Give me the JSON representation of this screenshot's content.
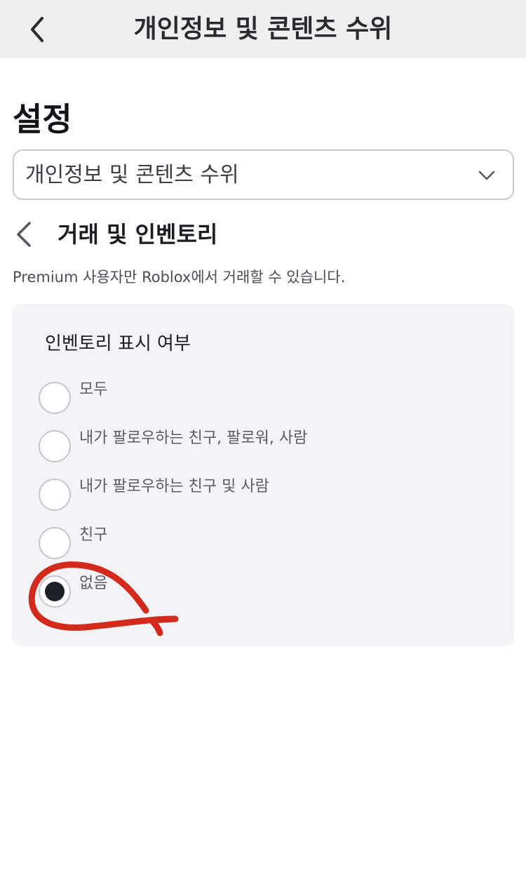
{
  "header": {
    "title": "개인정보 및 콘텐츠 수위",
    "back_icon": "chevron-left-icon"
  },
  "page": {
    "heading": "설정"
  },
  "category_select": {
    "value": "개인정보 및 콘텐츠 수위",
    "icon": "chevron-down-icon"
  },
  "section": {
    "title": "거래 및 인벤토리",
    "back_icon": "chevron-left-icon",
    "note": "Premium 사용자만 Roblox에서 거래할 수 있습니다."
  },
  "inventory_visibility": {
    "title": "인벤토리 표시 여부",
    "options": [
      {
        "label": "모두",
        "selected": false
      },
      {
        "label": "내가 팔로우하는 친구, 팔로워, 사람",
        "selected": false
      },
      {
        "label": "내가 팔로우하는 친구 및 사람",
        "selected": false
      },
      {
        "label": "친구",
        "selected": false
      },
      {
        "label": "없음",
        "selected": true
      }
    ]
  },
  "colors": {
    "header_bg": "#efeff0",
    "card_bg": "#f4f4f6",
    "radio_selected": "#1d2026",
    "annotation_stroke": "#d42a1c"
  }
}
